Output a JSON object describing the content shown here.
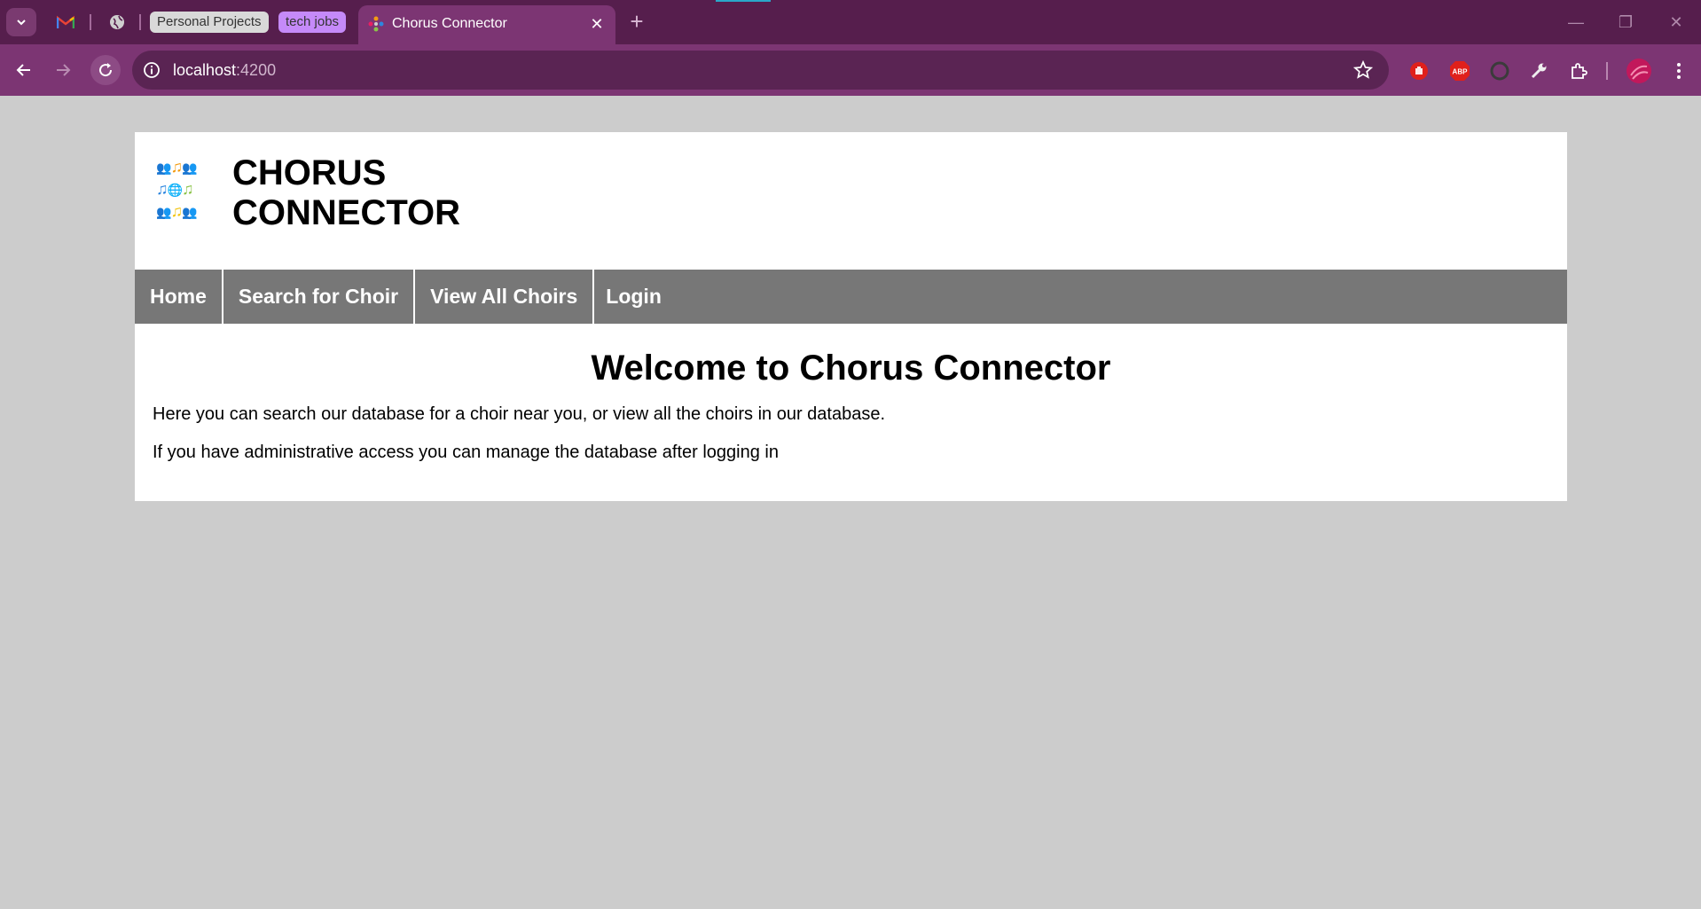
{
  "browser": {
    "tab_groups": [
      {
        "label": "Personal Projects",
        "color": "#d9d9d9"
      },
      {
        "label": "tech jobs",
        "color": "#c58af9"
      }
    ],
    "active_tab": {
      "title": "Chorus Connector",
      "close_glyph": "✕"
    },
    "new_tab_glyph": "+",
    "address_bar": {
      "host": "localhost",
      "port": ":4200"
    },
    "window_controls": {
      "minimize": "—",
      "restore": "❐",
      "close": "✕"
    },
    "extensions": [
      "hand-stop-icon",
      "adblock-plus-icon",
      "grammar-icon",
      "wrench-icon",
      "puzzle-icon",
      "profile-avatar"
    ],
    "theme": {
      "tabstrip": "#561e4d",
      "toolbar": "#7c3573",
      "omnibox": "#5a2453"
    }
  },
  "site": {
    "title_line1": "CHORUS",
    "title_line2": "CONNECTOR",
    "logo": {
      "rows": [
        [
          "👥",
          "♫",
          "👥"
        ],
        [
          "♫",
          "🌐",
          "♫"
        ],
        [
          "👥",
          "♫",
          "👥"
        ]
      ],
      "note_colors": [
        "#f39c12",
        "#2e86de",
        "#8bc34a",
        "#f1c40f"
      ]
    },
    "nav": [
      {
        "label": "Home"
      },
      {
        "label": "Search for Choir"
      },
      {
        "label": "View All Choirs"
      },
      {
        "label": "Login"
      }
    ],
    "heading": "Welcome to Chorus Connector",
    "paragraphs": [
      "Here you can search our database for a choir near you, or view all the choirs in our database.",
      "If you have administrative access you can manage the database after logging in"
    ]
  }
}
